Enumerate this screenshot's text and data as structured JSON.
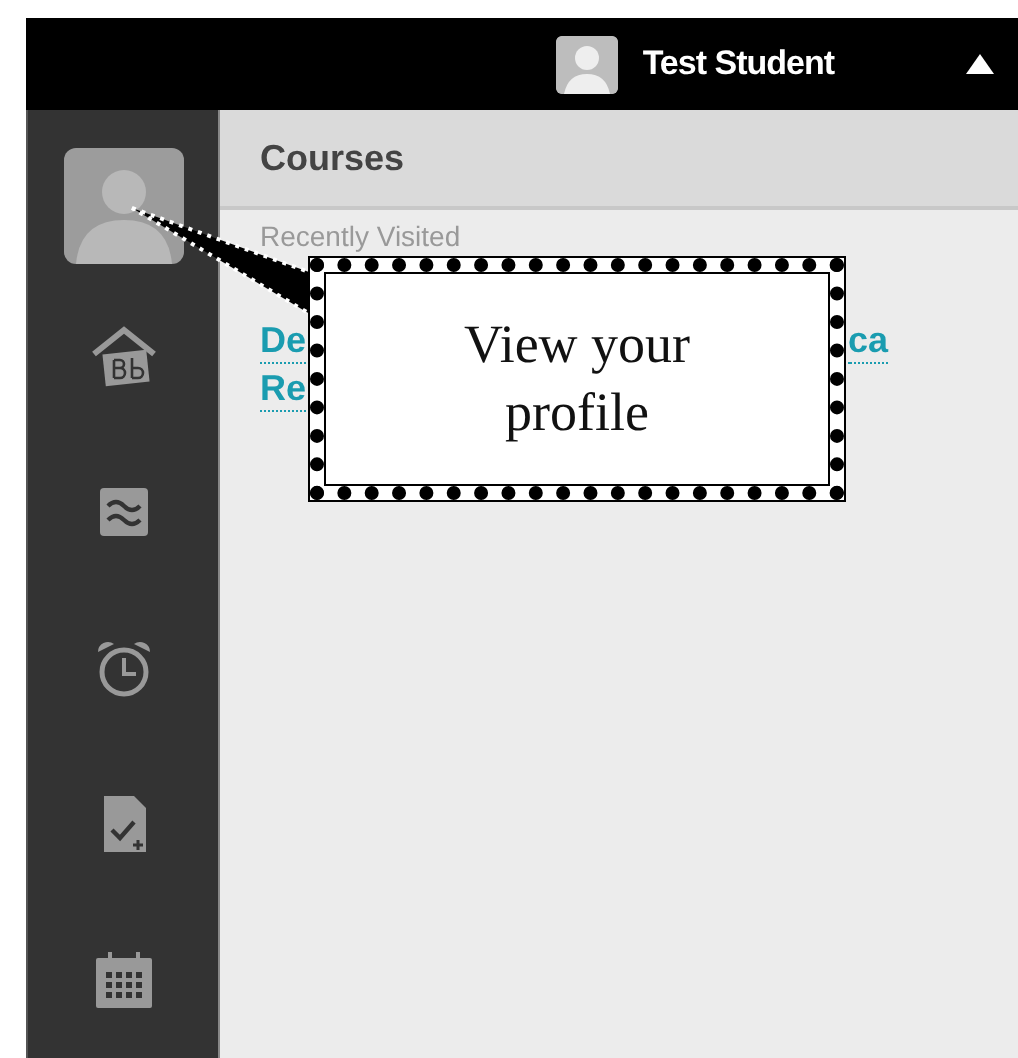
{
  "top_bar": {
    "user_name": "Test Student"
  },
  "panel": {
    "title": "Courses",
    "section": "Recently Visited",
    "link_rows": [
      [
        "De",
        "ca"
      ],
      [
        "Re"
      ]
    ]
  },
  "callout": {
    "text": "View your profile"
  }
}
